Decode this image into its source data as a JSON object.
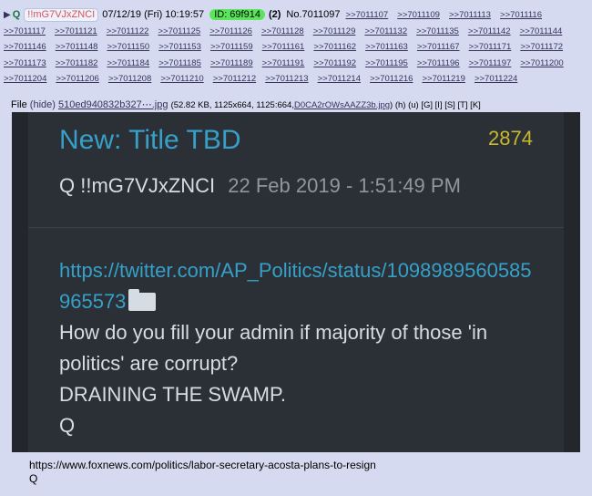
{
  "post": {
    "name": "Q",
    "tripcode": "!!mG7VJxZNCI",
    "date": "07/12/19 (Fri) 10:19:57",
    "id": "ID: 69f914",
    "count": "(2)",
    "number": "No.7011097",
    "replies": [
      ">>7011107",
      ">>7011109",
      ">>7011113",
      ">>7011116",
      ">>7011117",
      ">>7011121",
      ">>7011122",
      ">>7011125",
      ">>7011126",
      ">>7011128",
      ">>7011129",
      ">>7011132",
      ">>7011135",
      ">>7011142",
      ">>7011144",
      ">>7011146",
      ">>7011148",
      ">>7011150",
      ">>7011153",
      ">>7011159",
      ">>7011161",
      ">>7011162",
      ">>7011163",
      ">>7011167",
      ">>7011171",
      ">>7011172",
      ">>7011173",
      ">>7011182",
      ">>7011184",
      ">>7011185",
      ">>7011189",
      ">>7011191",
      ">>7011192",
      ">>7011195",
      ">>7011196",
      ">>7011197",
      ">>7011200",
      ">>7011204",
      ">>7011206",
      ">>7011208",
      ">>7011210",
      ">>7011212",
      ">>7011213",
      ">>7011214",
      ">>7011216",
      ">>7011219",
      ">>7011224"
    ]
  },
  "file": {
    "label": "File",
    "hide": "(hide)",
    "name": "510ed940832b327⋯.jpg",
    "meta": "(52.82 KB, 1125x664, 1125:664,",
    "orig": "D0CA2rOWsAAZZ3b.jpg",
    "links": ") (h) (u) [G] [I] [S] [T] [K]"
  },
  "image": {
    "title": "New: Title TBD",
    "number": "2874",
    "author": "Q",
    "trip": "!!mG7VJxZNCI",
    "stamp": "22 Feb 2019 - 1:51:49 PM",
    "link": "https://twitter.com/AP_Politics/status/1098989560585965573",
    "line1": "How do you fill your admin if majority of those 'in politics' are corrupt?",
    "line2": "DRAINING THE SWAMP.",
    "line3": "Q"
  },
  "comment": {
    "url": "https://www.foxnews.com/politics/labor-secretary-acosta-plans-to-resign",
    "sig": "Q"
  }
}
